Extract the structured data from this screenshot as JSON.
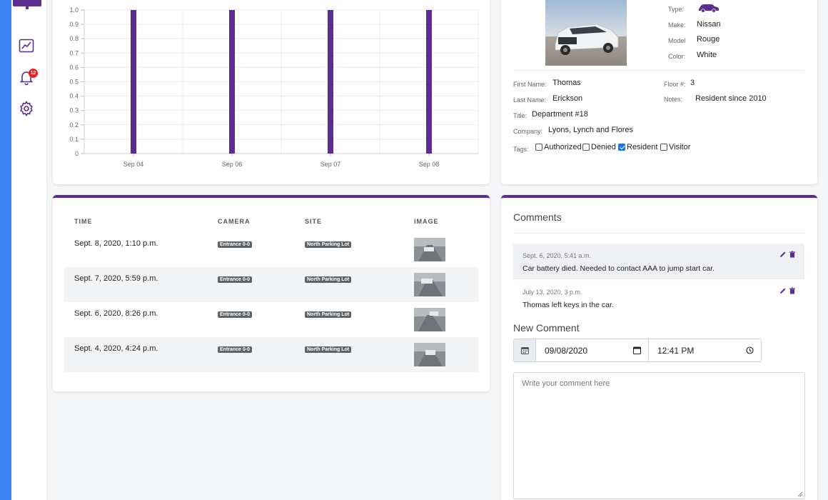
{
  "colors": {
    "accent": "#5b2d8e",
    "page_bg": "#3b82f6",
    "pill": "#5f6368"
  },
  "sidebar": {
    "top_icon": "monitor-icon",
    "items": [
      {
        "icon": "line-chart-icon"
      },
      {
        "icon": "bell-icon",
        "badge": "12"
      },
      {
        "icon": "gear-icon"
      }
    ]
  },
  "chart_data": {
    "type": "bar",
    "categories": [
      "Sep 04",
      "Sep 06",
      "Sep 07",
      "Sep 08"
    ],
    "values": [
      1.0,
      1.0,
      1.0,
      1.0
    ],
    "ylim": [
      0,
      1.0
    ],
    "yticks": [
      "0",
      "0.1",
      "0.2",
      "0.3",
      "0.4",
      "0.5",
      "0.6",
      "0.7",
      "0.8",
      "0.9",
      "1.0"
    ],
    "grid": true,
    "color": "#5b2d8e"
  },
  "vehicle": {
    "type_label": "Type:",
    "type_icon": "car-icon",
    "make_label": "Make:",
    "make": "Nissan",
    "model_label": "Model",
    "model": "Rouge",
    "color_label": "Color:",
    "color": "White"
  },
  "person": {
    "first_name_label": "First Name:",
    "first_name": "Thomas",
    "last_name_label": "Last Name:",
    "last_name": "Erickson",
    "title_label": "Title:",
    "title": "Department #18",
    "company_label": "Company:",
    "company": "Lyons, Lynch and Flores",
    "floor_label": "Floor #:",
    "floor": "3",
    "notes_label": "Notes:",
    "notes": "Resident since 2010",
    "tags_label": "Tags:",
    "tags": [
      {
        "label": "Authorized",
        "checked": false
      },
      {
        "label": "Denied",
        "checked": false
      },
      {
        "label": "Resident",
        "checked": true
      },
      {
        "label": "Visitor",
        "checked": false
      }
    ]
  },
  "events": {
    "headers": [
      "TIME",
      "CAMERA",
      "SITE",
      "IMAGE"
    ],
    "rows": [
      {
        "time": "Sept. 8, 2020, 1:10 p.m.",
        "camera": "Entrance 0-0",
        "site": "North Parking Lot"
      },
      {
        "time": "Sept. 7, 2020, 5:59 p.m.",
        "camera": "Entrance 0-0",
        "site": "North Parking Lot"
      },
      {
        "time": "Sept. 6, 2020, 8:26 p.m.",
        "camera": "Entrance 0-0",
        "site": "North Parking Lot"
      },
      {
        "time": "Sept. 4, 2020, 4:24 p.m.",
        "camera": "Entrance 0-0",
        "site": "North Parking Lot"
      }
    ]
  },
  "comments": {
    "title": "Comments",
    "items": [
      {
        "date": "Sept. 6, 2020, 5:41 a.m.",
        "text": "Car battery died. Needed to contact AAA to jump start car."
      },
      {
        "date": "July 13, 2020, 3 p.m.",
        "text": "Thomas left keys in the car."
      }
    ],
    "new_title": "New Comment",
    "date_value": "09/08/2020",
    "time_value": "12:41 PM",
    "placeholder": "Write your comment here"
  }
}
